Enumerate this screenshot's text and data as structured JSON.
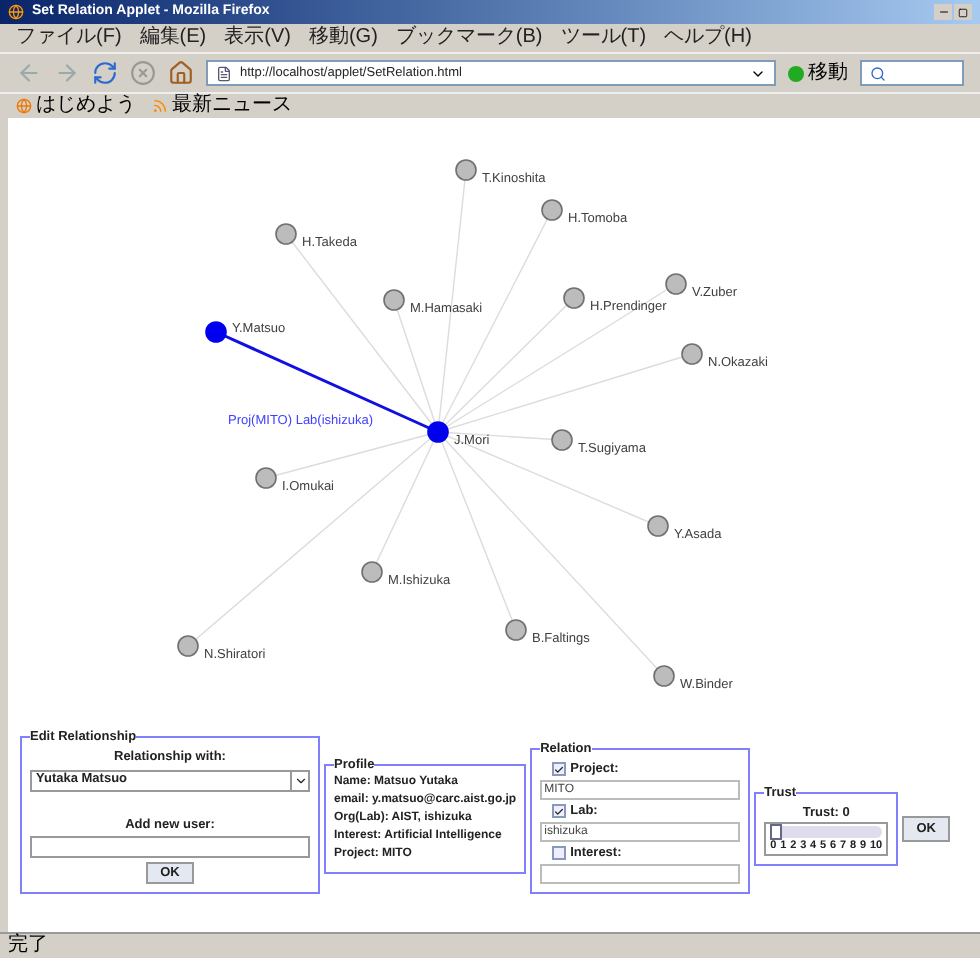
{
  "window": {
    "title": "Set Relation Applet - Mozilla Firefox"
  },
  "menu": [
    "ファイル(F)",
    "編集(E)",
    "表示(V)",
    "移動(G)",
    "ブックマーク(B)",
    "ツール(T)",
    "ヘルプ(H)"
  ],
  "address": {
    "value": "http://localhost/applet/SetRelation.html",
    "go": "移動"
  },
  "bookmarks": [
    "はじめよう",
    "最新ニュース"
  ],
  "graph": {
    "nodes": [
      {
        "name": "T.Kinoshita",
        "selected": false
      },
      {
        "name": "H.Tomoba",
        "selected": false
      },
      {
        "name": "H.Takeda",
        "selected": false
      },
      {
        "name": "M.Hamasaki",
        "selected": false
      },
      {
        "name": "H.Prendinger",
        "selected": false
      },
      {
        "name": "V.Zuber",
        "selected": false
      },
      {
        "name": "Y.Matsuo",
        "selected": true
      },
      {
        "name": "N.Okazaki",
        "selected": false
      },
      {
        "name": "J.Mori",
        "selected": true
      },
      {
        "name": "T.Sugiyama",
        "selected": false
      },
      {
        "name": "I.Omukai",
        "selected": false
      },
      {
        "name": "Y.Asada",
        "selected": false
      },
      {
        "name": "M.Ishizuka",
        "selected": false
      },
      {
        "name": "B.Faltings",
        "selected": false
      },
      {
        "name": "N.Shiratori",
        "selected": false
      },
      {
        "name": "W.Binder",
        "selected": false
      }
    ],
    "relation_label": "Proj(MITO) Lab(ishizuka)"
  },
  "edit_relationship": {
    "title": "Edit Relationship",
    "relationship_label": "Relationship with:",
    "relationship_value": "Yutaka Matsuo",
    "new_user_label": "Add new user:",
    "ok": "OK"
  },
  "profile": {
    "title": "Profile",
    "lines": [
      "Name: Matsuo Yutaka",
      "email: y.matsuo@carc.aist.go.jp",
      "Org(Lab): AIST, ishizuka",
      "Interest: Artificial Intelligence",
      "Project: MITO"
    ]
  },
  "relation": {
    "title": "Relation",
    "items": [
      {
        "label": "Project:",
        "checked": true,
        "value": "MITO"
      },
      {
        "label": "Lab:",
        "checked": true,
        "value": "ishizuka"
      },
      {
        "label": "Interest:",
        "checked": false
      }
    ]
  },
  "trust": {
    "title": "Trust",
    "reading": "Trust: 0",
    "level": 0,
    "ticks": [
      "0",
      "1",
      "2",
      "3",
      "4",
      "5",
      "6",
      "7",
      "8",
      "9",
      "10"
    ],
    "ok": "OK"
  },
  "status_bar": "完了"
}
